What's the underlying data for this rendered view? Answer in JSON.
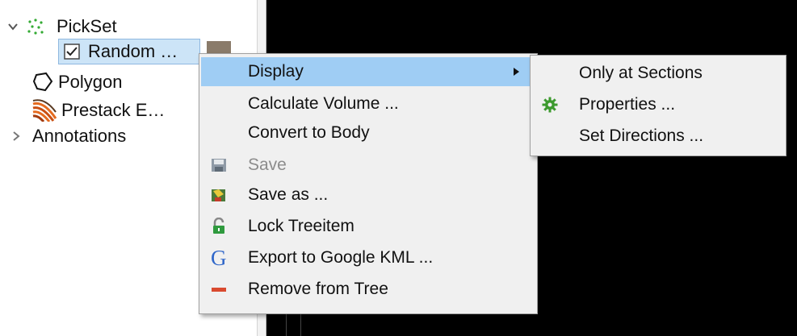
{
  "tree": {
    "items": [
      {
        "label": "PickSet",
        "icon": "pickset-dots-icon"
      },
      {
        "label": "Random …",
        "checked": true
      },
      {
        "label": "Polygon",
        "icon": "polygon-outline-icon"
      },
      {
        "label": "Prestack E…",
        "icon": "prestack-wiggle-icon"
      },
      {
        "label": "Annotations"
      }
    ]
  },
  "context_menu": {
    "items": [
      {
        "label": "Display",
        "highlighted": true,
        "has_submenu": true
      },
      {
        "label": "Calculate Volume ..."
      },
      {
        "label": "Convert to Body"
      },
      {
        "label": "Save",
        "disabled": true,
        "icon": "save-disk-icon"
      },
      {
        "label": "Save as ...",
        "icon": "save-as-icon"
      },
      {
        "label": "Lock Treeitem",
        "icon": "lock-open-icon"
      },
      {
        "label": "Export to Google KML ...",
        "icon": "google-g-icon"
      },
      {
        "label": "Remove from Tree",
        "icon": "remove-minus-icon"
      }
    ]
  },
  "submenu": {
    "items": [
      {
        "label": "Only at Sections"
      },
      {
        "label": "Properties ...",
        "icon": "gear-properties-icon"
      },
      {
        "label": "Set Directions ..."
      }
    ]
  },
  "colors": {
    "highlight": "#9fcdf4",
    "viewport": "#000000",
    "menu_bg": "#f0f0f0"
  }
}
